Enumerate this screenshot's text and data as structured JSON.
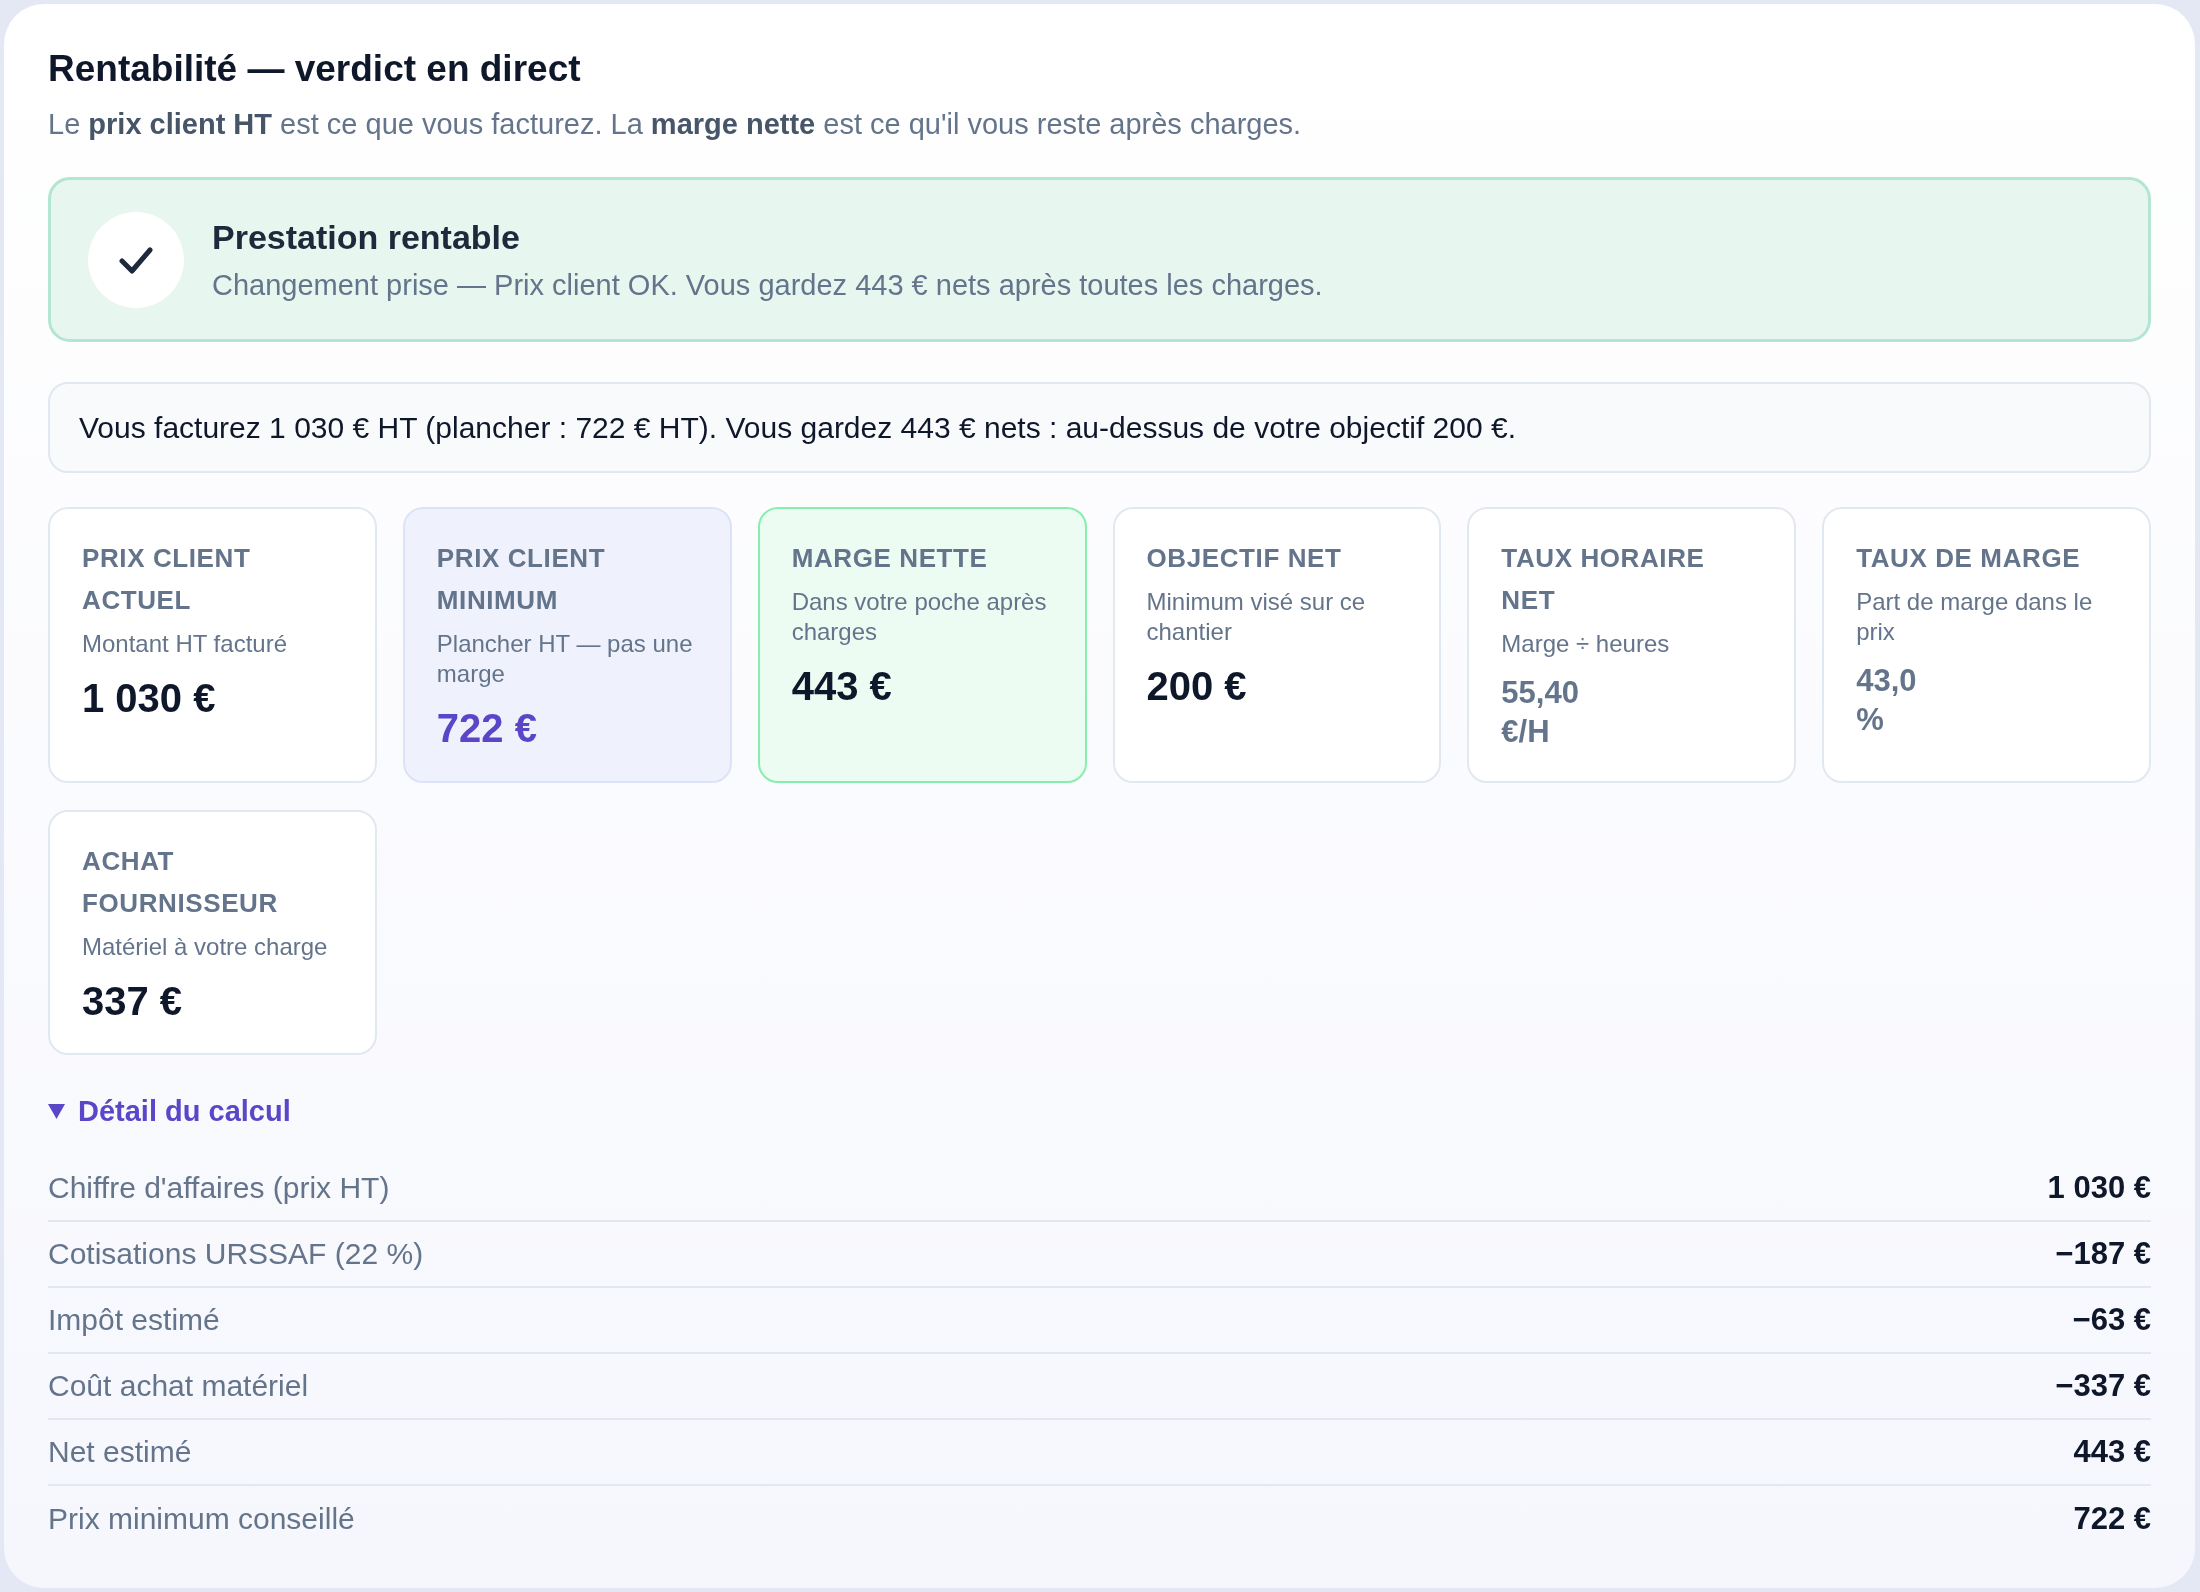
{
  "header": {
    "title": "Rentabilité — verdict en direct",
    "subtitle": "Le **prix client HT** est ce que vous facturez. La **marge nette** est ce qu'il vous reste après charges."
  },
  "verdict": {
    "kind": "success",
    "title": "Prestation rentable",
    "message": "Changement prise — Prix client OK. Vous gardez 443 € nets après toutes les charges."
  },
  "summary": "Vous facturez 1 030 € HT (plancher : 722 € HT). Vous gardez 443 € nets : au-dessus de votre objectif 200 €.",
  "metrics": [
    {
      "kind": "amount",
      "label": "PRIX CLIENT ACTUEL",
      "hint": "Montant HT facturé",
      "value": "1 030 €"
    },
    {
      "kind": "floor",
      "label": "PRIX CLIENT MINIMUM",
      "hint": "Plancher HT — pas une marge",
      "value": "722 €"
    },
    {
      "kind": "margin",
      "label": "MARGE NETTE",
      "hint": "Dans votre poche après charges",
      "value": "443 €"
    },
    {
      "kind": "amount",
      "label": "OBJECTIF NET",
      "hint": "Minimum visé sur ce chantier",
      "value": "200 €"
    },
    {
      "kind": "rate",
      "label": "TAUX HORAIRE NET",
      "hint": "Marge ÷ heures",
      "value": "55,40",
      "unit": "€/H"
    },
    {
      "kind": "rate",
      "label": "TAUX DE MARGE",
      "hint": "Part de marge dans le prix",
      "value": "43,0",
      "unit": "%"
    },
    {
      "kind": "amount",
      "label": "ACHAT FOURNISSEUR",
      "hint": "Matériel à votre charge",
      "value": "337 €"
    }
  ],
  "details": {
    "label": "Détail du calcul",
    "expanded": true,
    "rows": [
      {
        "label": "Chiffre d'affaires (prix HT)",
        "value": "1 030 €"
      },
      {
        "label": "Cotisations URSSAF (22 %)",
        "value": "−187 €"
      },
      {
        "label": "Impôt estimé",
        "value": "−63 €"
      },
      {
        "label": "Coût achat matériel",
        "value": "−337 €"
      },
      {
        "label": "Net estimé",
        "value": "443 €"
      },
      {
        "label": "Prix minimum conseillé",
        "value": "722 €"
      }
    ]
  }
}
